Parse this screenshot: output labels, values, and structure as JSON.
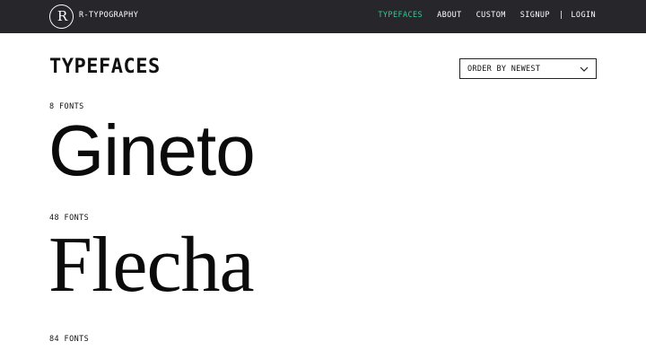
{
  "header": {
    "logo_text": "R",
    "brand": "R-TYPOGRAPHY",
    "nav": [
      {
        "label": "TYPEFACES",
        "active": true
      },
      {
        "label": "ABOUT"
      },
      {
        "label": "CUSTOM"
      },
      {
        "label": "SIGNUP"
      },
      {
        "label": "|"
      },
      {
        "label": "LOGIN"
      }
    ],
    "accent_color": "#2ecc8f",
    "background_color": "#26262b"
  },
  "main": {
    "title": "TYPEFACES",
    "sort": {
      "selected": "ORDER BY NEWEST",
      "icon": "chevron-down-icon"
    },
    "typefaces": [
      {
        "count": "8 FONTS",
        "name": "Gineto"
      },
      {
        "count": "48 FONTS",
        "name": "Flecha"
      },
      {
        "count": "84 FONTS",
        "name": ""
      }
    ]
  }
}
